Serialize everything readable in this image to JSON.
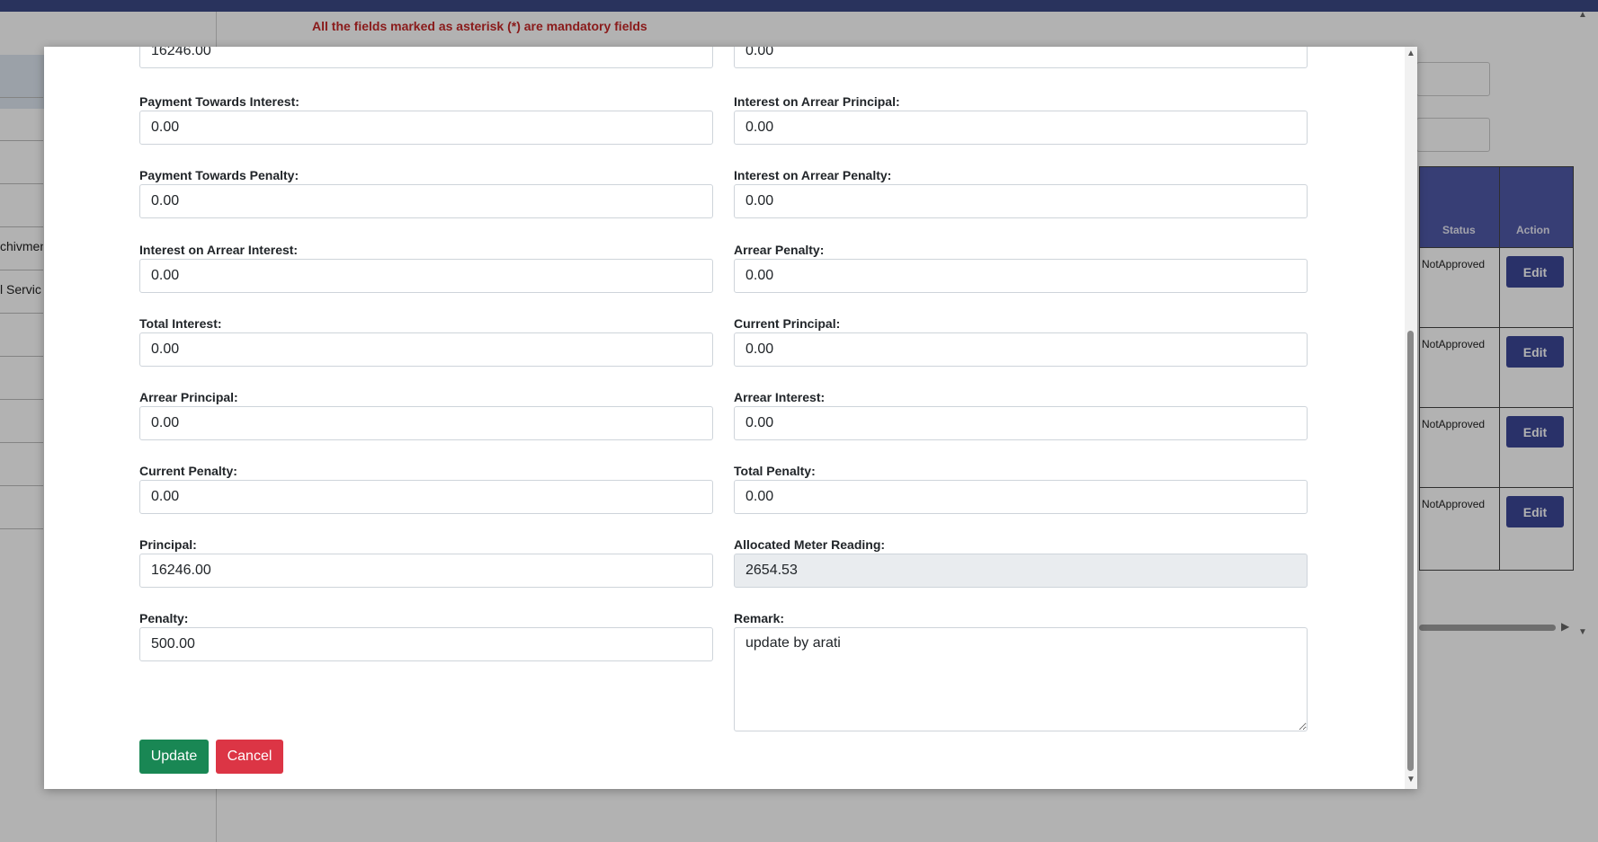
{
  "page": {
    "mandatory_note": "All the fields marked as asterisk (*) are mandatory fields",
    "sidebar_items": [
      "chivmen",
      "l Servic"
    ],
    "table": {
      "headers": {
        "status": "Status",
        "action": "Action"
      },
      "rows": [
        {
          "status": "NotApproved",
          "action": "Edit"
        },
        {
          "status": "NotApproved",
          "action": "Edit"
        },
        {
          "status": "NotApproved",
          "action": "Edit"
        },
        {
          "status": "NotApproved",
          "action": "Edit"
        }
      ]
    },
    "colors": {
      "header": "#3c4a86",
      "table_header": "#4f5aa8",
      "edit_button": "#3c4797"
    }
  },
  "modal": {
    "top_values": {
      "left": "16246.00",
      "right": "0.00"
    },
    "left_fields": [
      {
        "label": "Payment Towards Interest:",
        "value": "0.00"
      },
      {
        "label": "Payment Towards Penalty:",
        "value": "0.00"
      },
      {
        "label": "Interest on Arrear Interest:",
        "value": "0.00"
      },
      {
        "label": "Total Interest:",
        "value": "0.00"
      },
      {
        "label": "Arrear Principal:",
        "value": "0.00"
      },
      {
        "label": "Current Penalty:",
        "value": "0.00"
      },
      {
        "label": "Principal:",
        "value": "16246.00"
      },
      {
        "label": "Penalty:",
        "value": "500.00"
      }
    ],
    "right_fields": [
      {
        "label": "Interest on Arrear Principal:",
        "value": "0.00"
      },
      {
        "label": "Interest on Arrear Penalty:",
        "value": "0.00"
      },
      {
        "label": "Arrear Penalty:",
        "value": "0.00"
      },
      {
        "label": "Current Principal:",
        "value": "0.00"
      },
      {
        "label": "Arrear Interest:",
        "value": "0.00"
      },
      {
        "label": "Total Penalty:",
        "value": "0.00"
      },
      {
        "label": "Allocated Meter Reading:",
        "value": "2654.53"
      }
    ],
    "remark": {
      "label": "Remark:",
      "value": "update by arati"
    },
    "buttons": {
      "update": "Update",
      "cancel": "Cancel"
    },
    "colors": {
      "update": "#198754",
      "cancel": "#dc3545",
      "disabled_bg": "#e9ecef"
    }
  }
}
